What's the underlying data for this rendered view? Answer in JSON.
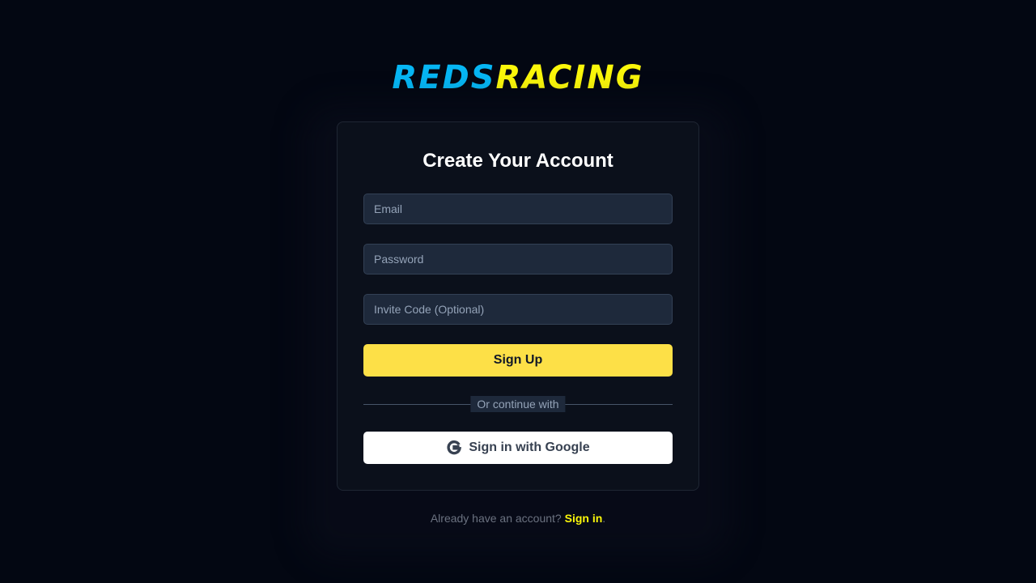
{
  "brand": {
    "part_a": "REDS",
    "part_b": "RACING",
    "color_a": "#06b6f4",
    "color_b": "#fbf70a"
  },
  "form": {
    "title": "Create Your Account",
    "email_placeholder": "Email",
    "password_placeholder": "Password",
    "invite_placeholder": "Invite Code (Optional)",
    "submit_label": "Sign Up",
    "divider_text": "Or continue with",
    "google_label": "Sign in with Google",
    "google_icon": "google-g-icon"
  },
  "footer": {
    "prompt": "Already have an account? ",
    "link_label": "Sign in",
    "suffix": "."
  },
  "colors": {
    "background": "#030712",
    "card": "#0b101b",
    "input": "#1e293b",
    "accent": "#fde047"
  }
}
